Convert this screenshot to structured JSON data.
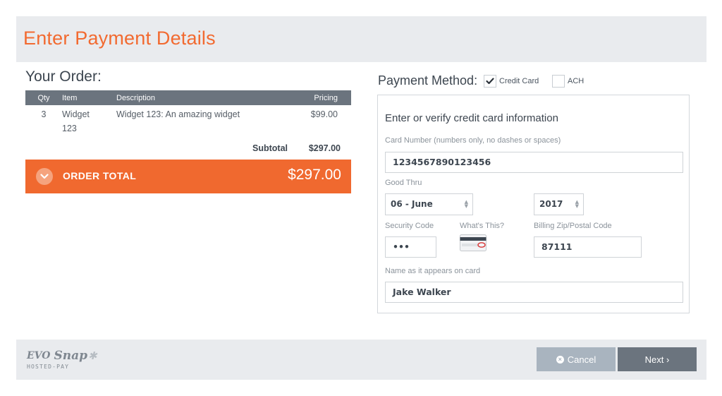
{
  "header": {
    "title": "Enter Payment Details"
  },
  "order": {
    "heading": "Your Order:",
    "columns": {
      "qty": "Qty",
      "item": "Item",
      "description": "Description",
      "pricing": "Pricing"
    },
    "rows": [
      {
        "qty": "3",
        "item": "Widget 123",
        "description": "Widget 123: An amazing widget",
        "pricing": "$99.00"
      }
    ],
    "subtotal_label": "Subtotal",
    "subtotal_value": "$297.00",
    "total_label": "ORDER TOTAL",
    "total_value": "$297.00"
  },
  "payment_method": {
    "label": "Payment Method:",
    "options": [
      {
        "label": "Credit Card",
        "checked": true
      },
      {
        "label": "ACH",
        "checked": false
      }
    ]
  },
  "card_form": {
    "heading": "Enter or verify credit card information",
    "card_number_label": "Card Number (numbers only, no dashes or spaces)",
    "card_number_value": "1234567890123456",
    "good_thru_label": "Good Thru",
    "month_value": "06 - June",
    "year_value": "2017",
    "security_code_label": "Security Code",
    "security_code_value": "•••",
    "whats_this_label": "What's This?",
    "zip_label": "Billing Zip/Postal Code",
    "zip_value": "87111",
    "name_label": "Name as it appears on card",
    "name_value": "Jake Walker"
  },
  "footer": {
    "logo_evo": "EVO",
    "logo_snap": "Snap",
    "logo_sub": "HOSTED-PAY",
    "cancel_label": "Cancel",
    "next_label": "Next ›"
  },
  "colors": {
    "accent": "#f26a30",
    "header_bg": "#e9ebee",
    "table_header": "#6b747e",
    "cancel_button": "#a9b4bf",
    "next_button": "#6b747e"
  }
}
